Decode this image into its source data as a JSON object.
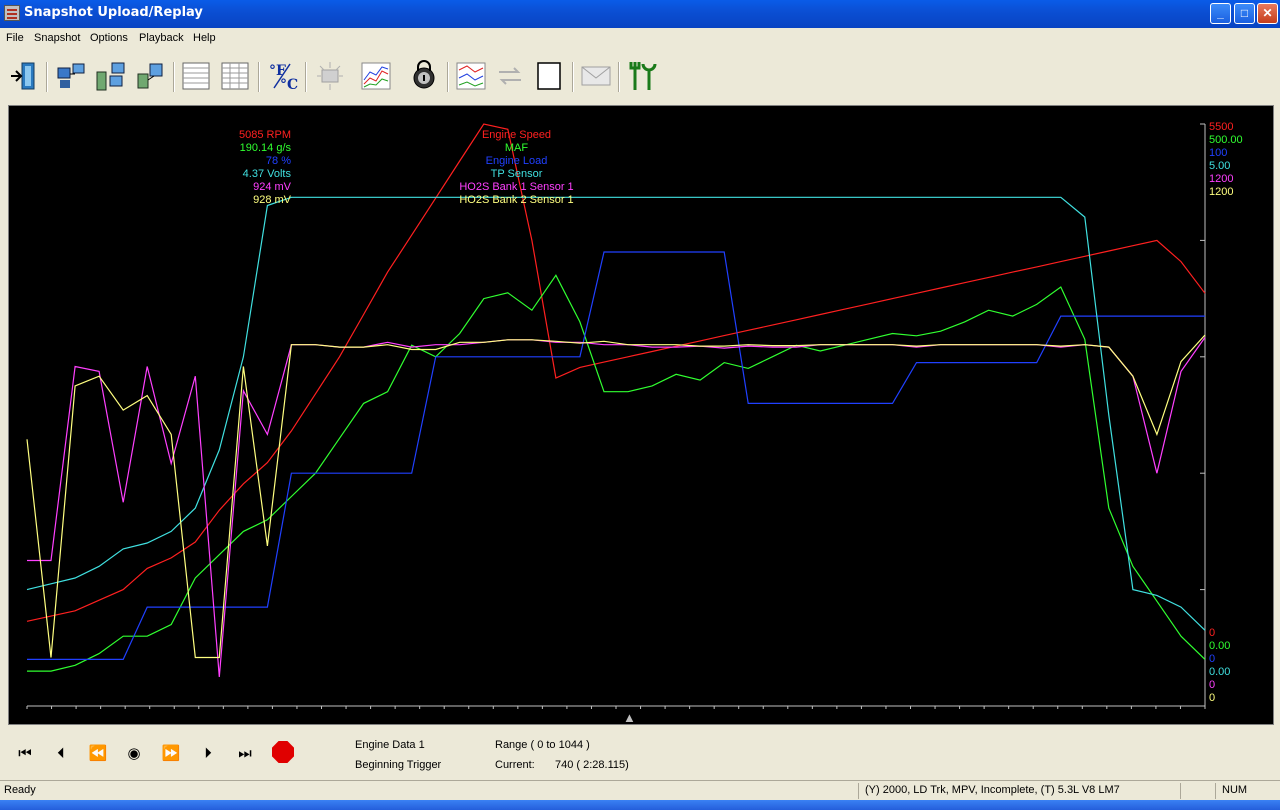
{
  "window": {
    "title": "Snapshot Upload/Replay",
    "minimize": "_",
    "maximize": "□",
    "close": "✕"
  },
  "menu": [
    "File",
    "Snapshot",
    "Options",
    "Playback",
    "Help"
  ],
  "toolbar": {
    "icons": [
      "exit-icon",
      "upload-icon",
      "multi-upload-icon",
      "network-icon",
      "table-icon",
      "grid-icon",
      "temp-units-icon",
      "flash-icon",
      "graph-icon",
      "lock-icon",
      "multi-graph-icon",
      "sync-icon",
      "page-icon",
      "email-icon",
      "tools-icon"
    ],
    "temp_label": "°F/°C"
  },
  "chart": {
    "values": [
      {
        "text": "5085 RPM",
        "color": "#ff2020"
      },
      {
        "text": "190.14 g/s",
        "color": "#30ff30"
      },
      {
        "text": "78 %",
        "color": "#2040ff"
      },
      {
        "text": "4.37 Volts",
        "color": "#40e0e0"
      },
      {
        "text": "924 mV",
        "color": "#ff40ff"
      },
      {
        "text": "928 mV",
        "color": "#ffff80"
      }
    ],
    "names": [
      {
        "text": "Engine Speed",
        "color": "#ff2020"
      },
      {
        "text": "MAF",
        "color": "#30ff30"
      },
      {
        "text": "Engine Load",
        "color": "#2040ff"
      },
      {
        "text": "TP Sensor",
        "color": "#40e0e0"
      },
      {
        "text": "HO2S Bank 1 Sensor 1",
        "color": "#ff40ff"
      },
      {
        "text": "HO2S Bank 2 Sensor 1",
        "color": "#ffff80"
      }
    ],
    "scale_max": [
      {
        "text": "5500",
        "color": "#ff2020"
      },
      {
        "text": "500.00",
        "color": "#30ff30"
      },
      {
        "text": "100",
        "color": "#2040ff"
      },
      {
        "text": "5.00",
        "color": "#40e0e0"
      },
      {
        "text": "1200",
        "color": "#ff40ff"
      },
      {
        "text": "1200",
        "color": "#ffff80"
      }
    ],
    "scale_min": [
      {
        "text": "0",
        "color": "#ff2020"
      },
      {
        "text": "0.00",
        "color": "#30ff30"
      },
      {
        "text": "0",
        "color": "#2040ff"
      },
      {
        "text": "0.00",
        "color": "#40e0e0"
      },
      {
        "text": "0",
        "color": "#ff40ff"
      },
      {
        "text": "0",
        "color": "#ffff80"
      }
    ]
  },
  "chart_data": {
    "type": "line",
    "x": [
      0,
      1,
      2,
      3,
      4,
      5,
      6,
      7,
      8,
      9,
      10,
      11,
      12,
      13,
      14,
      15,
      16,
      17,
      18,
      19,
      20,
      21,
      22,
      23,
      24,
      25,
      26,
      27,
      28,
      29,
      30,
      31,
      32,
      33,
      34,
      35,
      36,
      37,
      38,
      39,
      40,
      41,
      42,
      43,
      44,
      45,
      46,
      47,
      48,
      49
    ],
    "series": [
      {
        "name": "Engine Speed",
        "color": "#ff2020",
        "min": 0,
        "max": 5500,
        "values": [
          800,
          850,
          900,
          1000,
          1100,
          1300,
          1400,
          1550,
          1850,
          2100,
          2300,
          2600,
          2950,
          3300,
          3700,
          4100,
          4450,
          4800,
          5150,
          5500,
          5450,
          4400,
          3100,
          3200,
          3250,
          3300,
          3350,
          3400,
          3450,
          3500,
          3550,
          3600,
          3650,
          3700,
          3750,
          3800,
          3850,
          3900,
          3950,
          4000,
          4050,
          4100,
          4150,
          4200,
          4250,
          4300,
          4350,
          4400,
          4200,
          3900
        ]
      },
      {
        "name": "MAF",
        "color": "#30ff30",
        "min": 0,
        "max": 500.0,
        "values": [
          30,
          30,
          35,
          45,
          60,
          60,
          70,
          110,
          130,
          150,
          160,
          180,
          200,
          230,
          260,
          270,
          310,
          300,
          320,
          350,
          355,
          340,
          370,
          330,
          270,
          270,
          275,
          285,
          280,
          295,
          290,
          300,
          310,
          305,
          310,
          315,
          320,
          318,
          322,
          330,
          340,
          335,
          345,
          360,
          315,
          170,
          120,
          90,
          60,
          40
        ]
      },
      {
        "name": "Engine Load",
        "color": "#2040ff",
        "min": 0,
        "max": 100,
        "values": [
          8,
          8,
          8,
          8,
          8,
          17,
          17,
          17,
          17,
          17,
          17,
          40,
          40,
          40,
          40,
          40,
          40,
          60,
          60,
          60,
          60,
          60,
          60,
          60,
          78,
          78,
          78,
          78,
          78,
          78,
          52,
          52,
          52,
          52,
          52,
          52,
          52,
          59,
          59,
          59,
          59,
          59,
          59,
          67,
          67,
          67,
          67,
          67,
          67,
          67
        ]
      },
      {
        "name": "TP Sensor",
        "color": "#40e0e0",
        "min": 0,
        "max": 5.0,
        "values": [
          1.0,
          1.05,
          1.1,
          1.2,
          1.35,
          1.4,
          1.5,
          1.7,
          2.2,
          3.0,
          4.3,
          4.37,
          4.37,
          4.37,
          4.37,
          4.37,
          4.37,
          4.37,
          4.37,
          4.37,
          4.37,
          4.37,
          4.37,
          4.37,
          4.37,
          4.37,
          4.37,
          4.37,
          4.37,
          4.37,
          4.37,
          4.37,
          4.37,
          4.37,
          4.37,
          4.37,
          4.37,
          4.37,
          4.37,
          4.37,
          4.37,
          4.37,
          4.37,
          4.37,
          4.2,
          2.5,
          1.0,
          0.95,
          0.85,
          0.65
        ]
      },
      {
        "name": "HO2S Bank 1 Sensor 1",
        "color": "#ff40ff",
        "min": 0,
        "max": 1200,
        "values": [
          300,
          300,
          700,
          690,
          420,
          700,
          500,
          680,
          60,
          650,
          560,
          745,
          745,
          740,
          740,
          750,
          740,
          745,
          745,
          750,
          755,
          755,
          750,
          750,
          745,
          745,
          740,
          740,
          742,
          738,
          742,
          740,
          740,
          745,
          745,
          745,
          745,
          740,
          745,
          745,
          745,
          745,
          745,
          740,
          745,
          740,
          680,
          480,
          690,
          760
        ]
      },
      {
        "name": "HO2S Bank 2 Sensor 1",
        "color": "#ffff80",
        "min": 0,
        "max": 1200,
        "values": [
          550,
          100,
          660,
          680,
          610,
          640,
          560,
          100,
          100,
          700,
          330,
          745,
          745,
          740,
          740,
          745,
          735,
          735,
          750,
          750,
          755,
          755,
          752,
          748,
          752,
          745,
          745,
          745,
          742,
          742,
          745,
          743,
          743,
          745,
          745,
          745,
          745,
          742,
          745,
          745,
          745,
          745,
          745,
          742,
          745,
          740,
          680,
          560,
          710,
          765
        ]
      }
    ]
  },
  "playback": {
    "buttons": [
      "skip-start-icon",
      "step-back-icon",
      "rewind-icon",
      "play-icon",
      "fast-forward-icon",
      "step-forward-icon",
      "skip-end-icon"
    ],
    "glyphs": [
      "⏮",
      "⏴",
      "⏪",
      "◉",
      "⏩",
      "⏵",
      "⏭"
    ],
    "engine_data": "Engine Data 1",
    "trigger": "Beginning Trigger",
    "range": "Range ( 0 to 1044 )",
    "current_label": "Current:",
    "current_value": "740 ( 2:28.115)"
  },
  "status": {
    "left": "Ready",
    "vehicle": "(Y) 2000, LD Trk, MPV, Incomplete, (T) 5.3L  V8 LM7",
    "num": "NUM"
  }
}
